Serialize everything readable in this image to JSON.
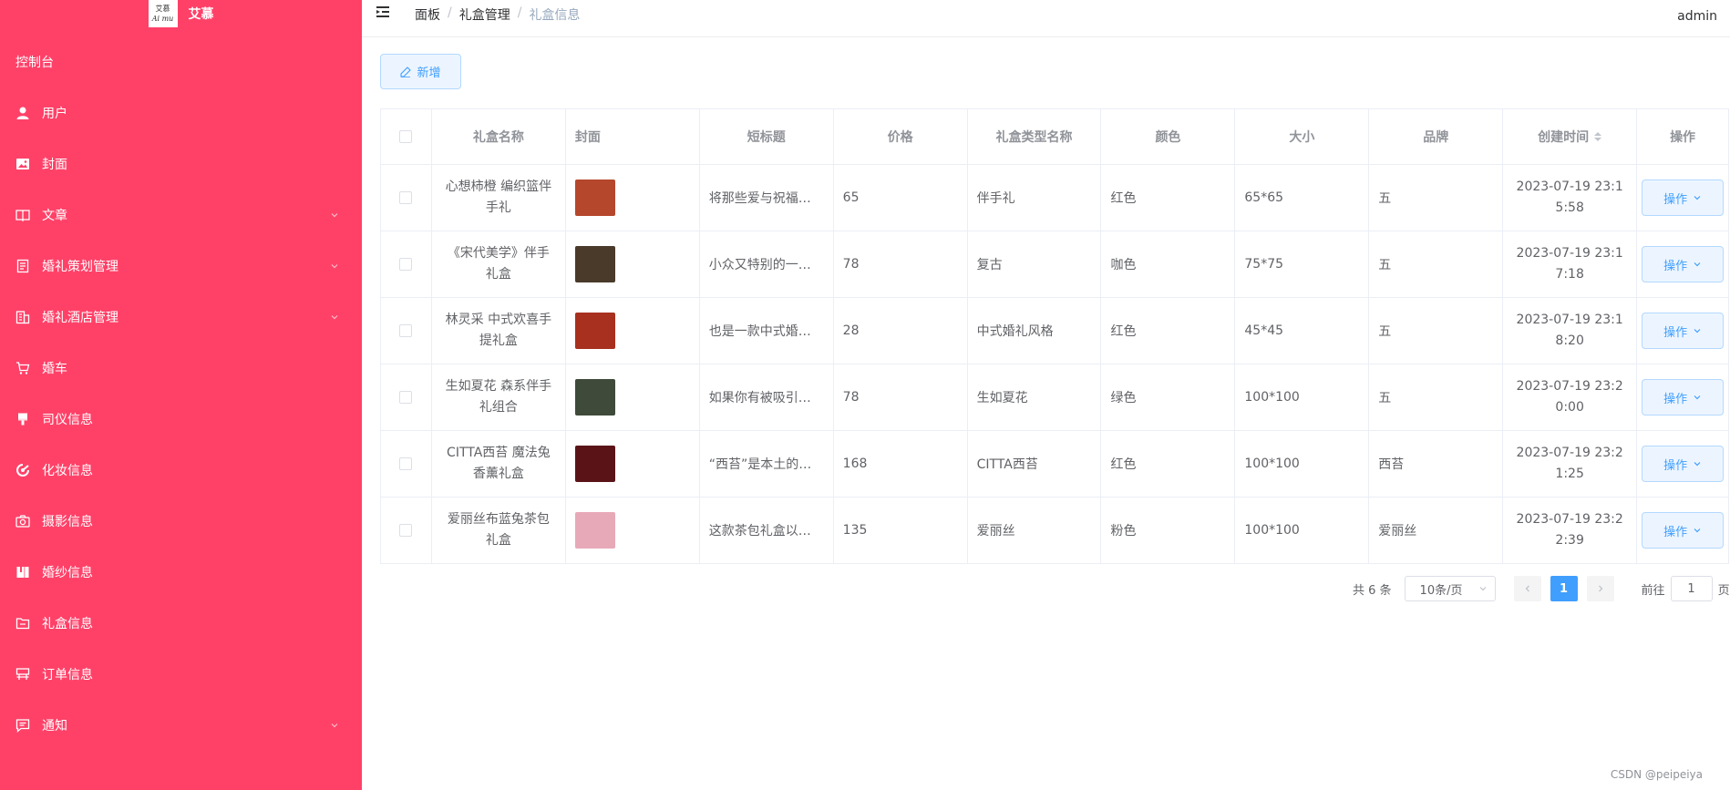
{
  "app": {
    "logo_line1": "艾慕",
    "logo_line2": "Ai mu",
    "name": "艾慕",
    "user": "admin",
    "watermark": "CSDN @peipeiya"
  },
  "sidebar": {
    "console": "控制台",
    "items": [
      {
        "label": "用户",
        "icon": "user-icon",
        "has_arrow": false
      },
      {
        "label": "封面",
        "icon": "picture-icon",
        "has_arrow": false
      },
      {
        "label": "文章",
        "icon": "book-icon",
        "has_arrow": true
      },
      {
        "label": "婚礼策划管理",
        "icon": "document-icon",
        "has_arrow": true
      },
      {
        "label": "婚礼酒店管理",
        "icon": "building-icon",
        "has_arrow": true
      },
      {
        "label": "婚车",
        "icon": "cart-icon",
        "has_arrow": false
      },
      {
        "label": "司仪信息",
        "icon": "brush-icon",
        "has_arrow": false
      },
      {
        "label": "化妆信息",
        "icon": "makeup-icon",
        "has_arrow": false
      },
      {
        "label": "摄影信息",
        "icon": "camera-icon",
        "has_arrow": false
      },
      {
        "label": "婚纱信息",
        "icon": "notebook-icon",
        "has_arrow": false
      },
      {
        "label": "礼盒信息",
        "icon": "folder-icon",
        "has_arrow": false
      },
      {
        "label": "订单信息",
        "icon": "order-icon",
        "has_arrow": false
      },
      {
        "label": "通知",
        "icon": "message-icon",
        "has_arrow": true
      }
    ]
  },
  "breadcrumb": [
    "面板",
    "礼盒管理",
    "礼盒信息"
  ],
  "toolbar": {
    "add_label": "新增"
  },
  "table": {
    "headers": [
      "礼盒名称",
      "封面",
      "短标题",
      "价格",
      "礼盒类型名称",
      "颜色",
      "大小",
      "品牌",
      "创建时间",
      "操作"
    ],
    "rows": [
      {
        "name": "心想柿橙 编织篮伴手礼",
        "short": "将那些爱与祝福都装进小篮子里",
        "price": "65",
        "type": "伴手礼",
        "color": "红色",
        "size": "65*65",
        "brand": "五",
        "time": "2023-07-19 23:15:58",
        "thumb_color": "#b5472d",
        "op": "操作"
      },
      {
        "name": "《宋代美学》伴手礼盒",
        "short": "小众又特别的一款宋代美学礼盒",
        "price": "78",
        "type": "复古",
        "color": "咖色",
        "size": "75*75",
        "brand": "五",
        "time": "2023-07-19 23:17:18",
        "thumb_color": "#4a3a2a",
        "op": "操作"
      },
      {
        "name": "林灵采 中式欢喜手提礼盒",
        "short": "也是一款中式婚礼风格礼盒",
        "price": "28",
        "type": "中式婚礼风格",
        "color": "红色",
        "size": "45*45",
        "brand": "五",
        "time": "2023-07-19 23:18:20",
        "thumb_color": "#a8301e",
        "op": "操作"
      },
      {
        "name": "生如夏花 森系伴手礼组合",
        "short": "如果你有被吸引，那就带走它吧",
        "price": "78",
        "type": "生如夏花",
        "color": "绿色",
        "size": "100*100",
        "brand": "五",
        "time": "2023-07-19 23:20:00",
        "thumb_color": "#3f4a3a",
        "op": "操作"
      },
      {
        "name": "CITTA西苔 魔法兔香薰礼盒",
        "short": "“西苔”是本土的一个香氛品牌",
        "price": "168",
        "type": "CITTA西苔",
        "color": "红色",
        "size": "100*100",
        "brand": "西苔",
        "time": "2023-07-19 23:21:25",
        "thumb_color": "#5a1418",
        "op": "操作"
      },
      {
        "name": "爱丽丝布蓝兔茶包礼盒",
        "short": "这款茶包礼盒以爱丽丝为主题",
        "price": "135",
        "type": "爱丽丝",
        "color": "粉色",
        "size": "100*100",
        "brand": "爱丽丝",
        "time": "2023-07-19 23:22:39",
        "thumb_color": "#e7a9b8",
        "op": "操作"
      }
    ]
  },
  "pagination": {
    "total": "共 6 条",
    "page_size": "10条/页",
    "current": "1",
    "goto_prefix": "前往",
    "goto_value": "1",
    "goto_suffix": "页"
  }
}
